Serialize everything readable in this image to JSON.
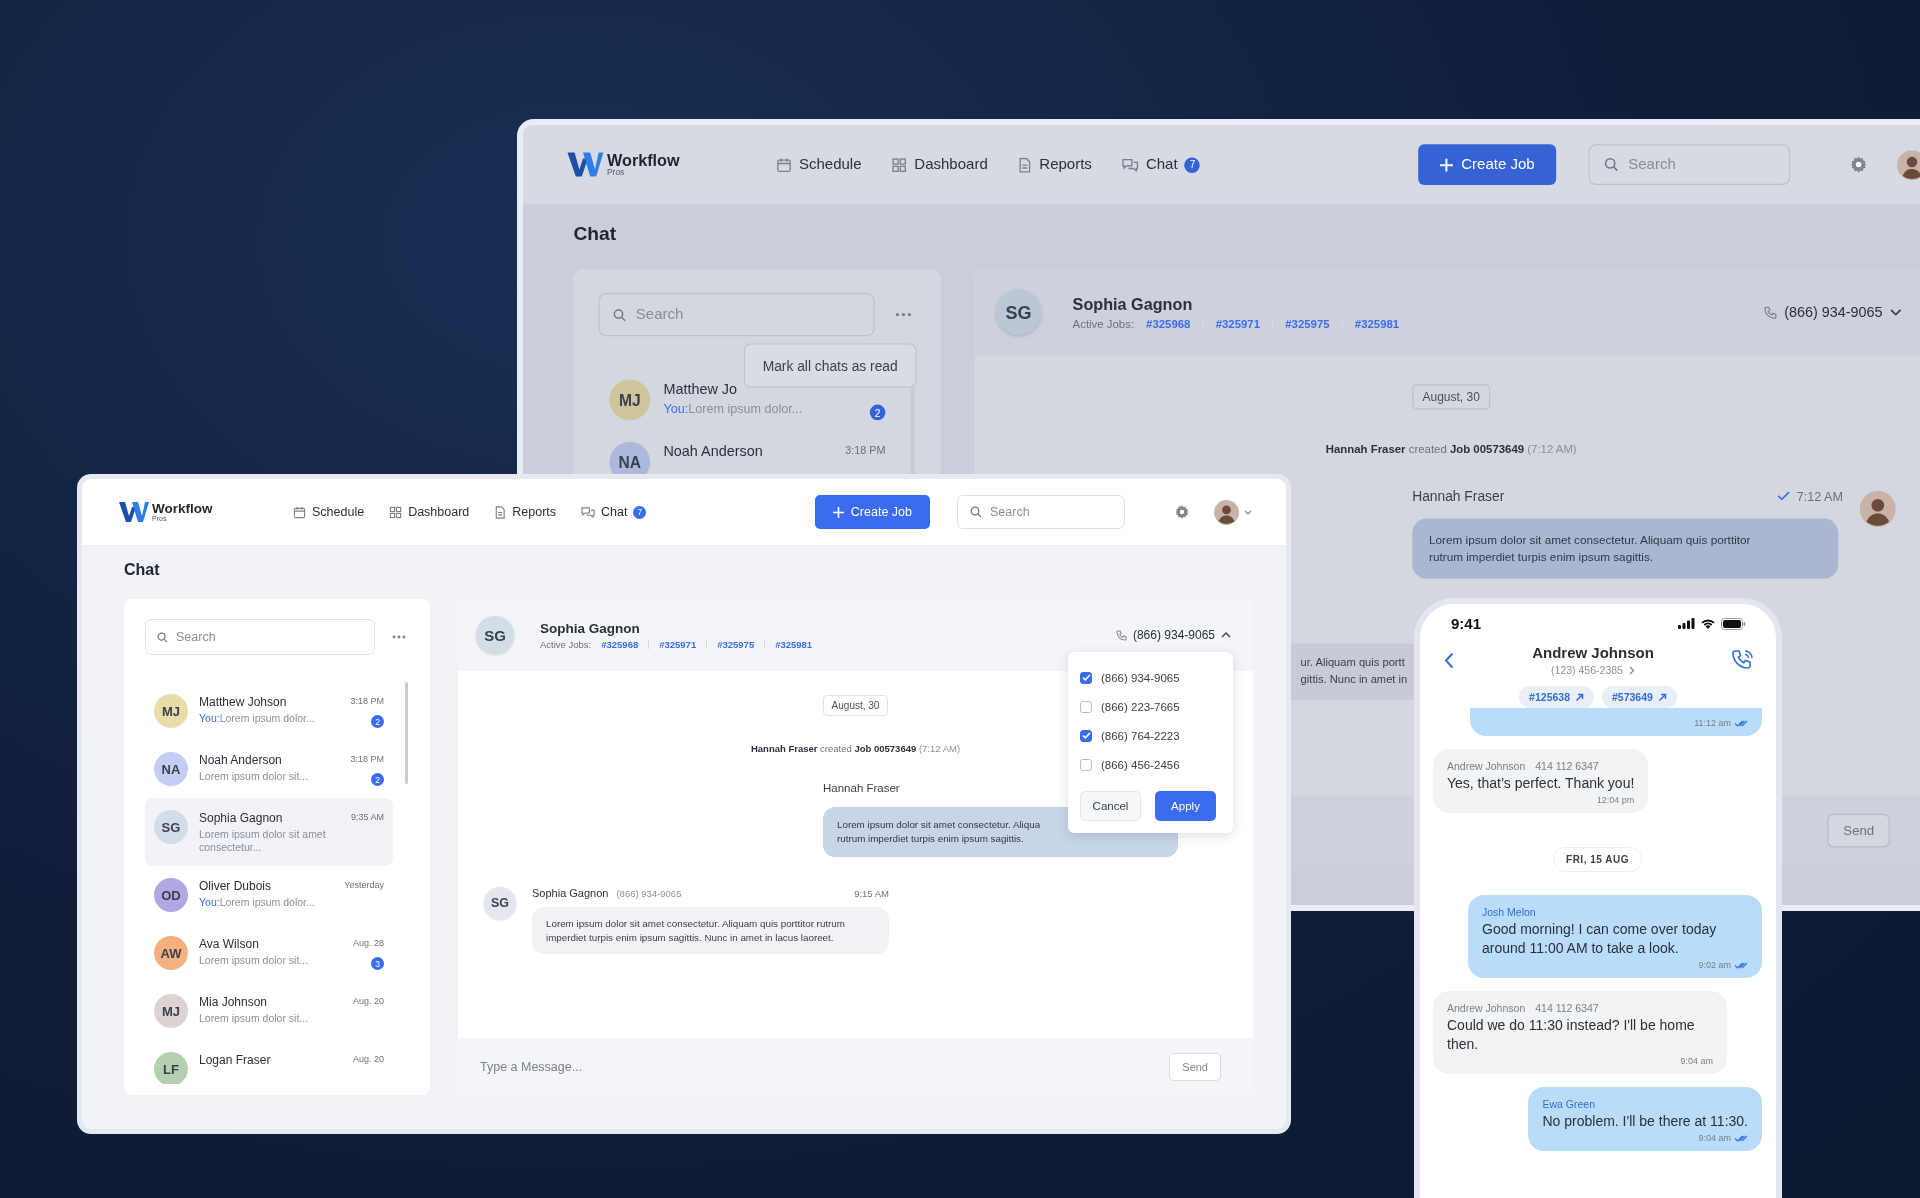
{
  "back_window": {
    "nav": {
      "brand": "Workflow",
      "brand_sub": "Pros",
      "links": [
        {
          "label": "Schedule"
        },
        {
          "label": "Dashboard"
        },
        {
          "label": "Reports"
        },
        {
          "label": "Chat",
          "badge": "7"
        }
      ],
      "create_button": "Create Job",
      "search_placeholder": "Search",
      "avatar_menu": false
    },
    "title": "Chat",
    "chat_list": {
      "search_placeholder": "Search",
      "menu_tooltip": "Mark all chats as read",
      "items": [
        {
          "initials": "MJ",
          "color": "#cfc59c",
          "name": "Matthew Jo",
          "author": "You:",
          "preview": "Lorem ipsum dolor...",
          "badge": "2"
        },
        {
          "initials": "NA",
          "color": "#aeb7dc",
          "name": "Noah Anderson",
          "time": "3:18 PM"
        }
      ]
    },
    "conversation": {
      "initials": "SG",
      "name": "Sophia Gagnon",
      "jobs_label": "Active Jobs:",
      "jobs": [
        "#325968",
        "#325971",
        "#325975",
        "#325981"
      ],
      "phone": "(866) 934-9065",
      "expanded": false,
      "date": "August, 30",
      "event": {
        "actor": "Hannah Fraser",
        "verb": "created",
        "object": "Job 00573649",
        "time": "(7:12 AM)"
      },
      "messages": [
        {
          "kind": "outgoing",
          "author": "Hannah Fraser",
          "time": "7:12 AM",
          "lines": [
            "Lorem ipsum dolor sit amet consectetur. Aliquam quis porttitor",
            "rutrum imperdiet turpis enim ipsum sagittis."
          ]
        },
        {
          "kind": "incoming",
          "lines": [
            "ur. Aliquam quis portt",
            "gittis. Nunc in amet in"
          ]
        }
      ],
      "send": "Send"
    }
  },
  "front_window": {
    "nav": {
      "brand": "Workflow",
      "brand_sub": "Pros",
      "links": [
        {
          "label": "Schedule"
        },
        {
          "label": "Dashboard"
        },
        {
          "label": "Reports"
        },
        {
          "label": "Chat",
          "badge": "7"
        }
      ],
      "create_button": "Create Job",
      "search_placeholder": "Search",
      "avatar_menu": true
    },
    "title": "Chat",
    "chat_list": {
      "search_placeholder": "Search",
      "items": [
        {
          "initials": "MJ",
          "color": "#e8dca8",
          "name": "Matthew Johson",
          "author": "You:",
          "preview": "Lorem ipsum dolor...",
          "time": "3:18 PM",
          "badge": "2",
          "selected": false
        },
        {
          "initials": "NA",
          "color": "#c5cdf5",
          "name": "Noah Anderson",
          "preview": "Lorem ipsum dolor sit...",
          "time": "3:18 PM",
          "badge": "2",
          "selected": false
        },
        {
          "initials": "SG",
          "color": "#d3dde8",
          "name": "Sophia Gagnon",
          "preview": "Lorem ipsum dolor sit amet consectetur...",
          "time": "9:35 AM",
          "selected": true
        },
        {
          "initials": "OD",
          "color": "#b3a6e3",
          "name": "Oliver Dubois",
          "author": "You:",
          "preview": "Lorem ipsum dolor...",
          "time": "Yesterday",
          "selected": false
        },
        {
          "initials": "AW",
          "color": "#f5b07f",
          "name": "Ava Wilson",
          "preview": "Lorem ipsum dolor sit...",
          "time": "Aug. 28",
          "badge": "3",
          "selected": false
        },
        {
          "initials": "MJ",
          "color": "#ddd3d3",
          "name": "Mia Johnson",
          "preview": "Lorem ipsum dolor sit...",
          "time": "Aug. 20",
          "selected": false
        },
        {
          "initials": "LF",
          "color": "#b5d0ae",
          "name": "Logan Fraser",
          "time": "Aug. 20",
          "selected": false
        }
      ]
    },
    "conversation": {
      "initials": "SG",
      "name": "Sophia Gagnon",
      "jobs_label": "Active Jobs:",
      "jobs": [
        "#325968",
        "#325971",
        "#325975",
        "#325981"
      ],
      "phone": "(866) 934-9065",
      "expanded": true,
      "phone_menu": {
        "options": [
          {
            "number": "(866) 934-9065",
            "checked": true
          },
          {
            "number": "(866) 223-7665",
            "checked": false
          },
          {
            "number": "(866) 764-2223",
            "checked": true
          },
          {
            "number": "(866) 456-2456",
            "checked": false
          }
        ],
        "cancel": "Cancel",
        "apply": "Apply"
      },
      "date": "August, 30",
      "event": {
        "actor": "Hannah Fraser",
        "verb": "created",
        "object": "Job 00573649",
        "time": "(7:12 AM)"
      },
      "messages": [
        {
          "kind": "outgoing",
          "author": "Hannah Fraser",
          "lines": [
            "Lorem ipsum dolor sit amet consectetur. Aliqua",
            "rutrum imperdiet turpis enim ipsum sagittis."
          ]
        },
        {
          "kind": "incoming",
          "initials": "SG",
          "author": "Sophia Gagnon",
          "phone": "(866) 934-9065",
          "time": "9:15 AM",
          "lines": [
            "Lorem ipsum dolor sit amet consectetur. Aliquam quis porttitor rutrum imperdiet turpis enim ipsum sagittis. Nunc in amet in lacus laoreet."
          ]
        }
      ],
      "composer_placeholder": "Type a Message...",
      "send": "Send"
    }
  },
  "phone": {
    "clock": "9:41",
    "contact": "Andrew Johnson",
    "contact_phone": "(123) 456-2385",
    "jobs": [
      "#125638",
      "#573649"
    ],
    "messages": [
      {
        "kind": "outgoing",
        "time": "11:12 am"
      },
      {
        "kind": "incoming",
        "author": "Andrew Johnson",
        "phone": "414 112 6347",
        "text": "Yes, that’s perfect. Thank you!",
        "time": "12:04 pm"
      },
      {
        "kind": "date",
        "text": "FRI, 15 AUG"
      },
      {
        "kind": "outgoing",
        "author": "Josh Melon",
        "text": "Good morning! I can come over today around 11:00 AM to take a look.",
        "time": "9:02 am"
      },
      {
        "kind": "incoming",
        "author": "Andrew Johnson",
        "phone": "414 112 6347",
        "text": "Could we do 11:30 instead? I'll be home then.",
        "time": "9:04 am"
      },
      {
        "kind": "outgoing",
        "author": "Ewa Green",
        "text": "No problem. I'll be there at 11:30.",
        "time": "9:04 am"
      }
    ]
  }
}
